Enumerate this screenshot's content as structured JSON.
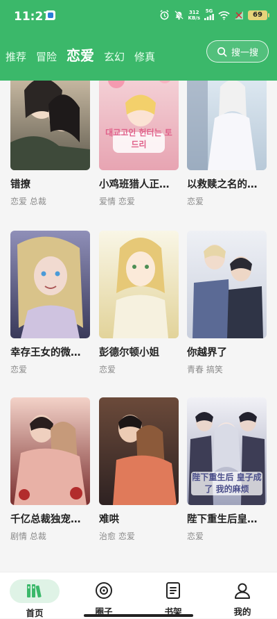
{
  "status_bar": {
    "time": "11:27",
    "net_speed_value": "312",
    "net_speed_unit": "KB/s",
    "network_type": "5G",
    "battery": "69"
  },
  "tabs": [
    {
      "label": "推荐",
      "active": false
    },
    {
      "label": "冒险",
      "active": false
    },
    {
      "label": "恋爱",
      "active": true
    },
    {
      "label": "玄幻",
      "active": false
    },
    {
      "label": "修真",
      "active": false
    }
  ],
  "search": {
    "label": "搜一搜"
  },
  "comics": [
    {
      "title": "错撩",
      "tags": "恋爱 总裁",
      "cover_colors": [
        "#d9c9b0",
        "#5f5a4e"
      ]
    },
    {
      "title": "小鸡班猎人正…",
      "tags": "爱情 恋爱",
      "cover_colors": [
        "#f3c6cc",
        "#d98a9a"
      ],
      "cover_text": "대교고인 헌터는 토드리"
    },
    {
      "title": "以救赎之名的…",
      "tags": "恋爱",
      "cover_colors": [
        "#e3edf5",
        "#b8c9d8"
      ]
    },
    {
      "title": "幸存王女的微…",
      "tags": "恋爱",
      "cover_colors": [
        "#8f8fb8",
        "#3a3a5a"
      ]
    },
    {
      "title": "彭德尔顿小姐",
      "tags": "恋爱",
      "cover_colors": [
        "#f4efd6",
        "#e2d39a"
      ]
    },
    {
      "title": "你越界了",
      "tags": "青春 搞笑",
      "cover_colors": [
        "#e6e8f0",
        "#4a5678"
      ]
    },
    {
      "title": "千亿总裁独宠…",
      "tags": "剧情 总裁",
      "cover_colors": [
        "#f0c6c0",
        "#7a2f2f"
      ]
    },
    {
      "title": "难哄",
      "tags": "治愈 恋爱",
      "cover_colors": [
        "#c27a55",
        "#3a2a2a"
      ]
    },
    {
      "title": "陛下重生后皇…",
      "tags": "恋爱",
      "cover_colors": [
        "#e6e6ee",
        "#4d4d66"
      ],
      "cover_text": "陛下重生后 皇子成了 我的麻烦"
    }
  ],
  "bottom_nav": [
    {
      "label": "首页",
      "icon": "home-books-icon",
      "active": true
    },
    {
      "label": "圈子",
      "icon": "circle-target-icon",
      "active": false
    },
    {
      "label": "书架",
      "icon": "bookshelf-icon",
      "active": false
    },
    {
      "label": "我的",
      "icon": "profile-icon",
      "active": false
    }
  ],
  "colors": {
    "brand": "#3bb86a",
    "active_nav_bg": "#dff3e6",
    "tag_text": "#8a8a8a"
  }
}
